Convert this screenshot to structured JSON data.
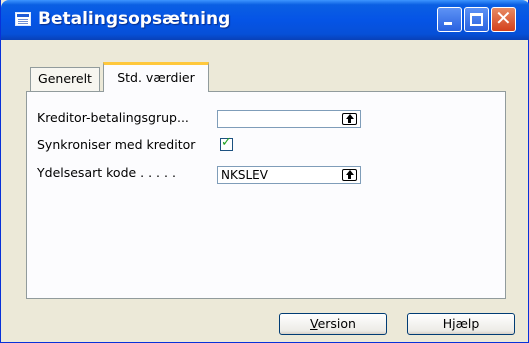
{
  "window": {
    "title": "Betalingsopsætning"
  },
  "titlebar_buttons": {
    "minimize_icon": "minimize-icon",
    "maximize_icon": "maximize-icon",
    "close_icon": "close-icon",
    "close_glyph": "✕"
  },
  "tabs": [
    {
      "label": "Generelt",
      "active": false
    },
    {
      "label": "Std. værdier",
      "active": true
    }
  ],
  "form": {
    "fields": [
      {
        "label": "Kreditor-betalingsgrup...",
        "value": "",
        "has_lookup": true
      },
      {
        "label": "Synkroniser med kreditor",
        "checked": true,
        "check_glyph": "✓"
      },
      {
        "label": "Ydelsesart kode . . . . .",
        "value": "NKSLEV",
        "has_lookup": true
      }
    ]
  },
  "buttons": {
    "version_prefix": "V",
    "version_rest": "ersion",
    "help_label": "Hjælp"
  },
  "colors": {
    "titlebar": "#0554e6",
    "accent_tab": "#ffc83c",
    "window_bg": "#ece9d8"
  }
}
